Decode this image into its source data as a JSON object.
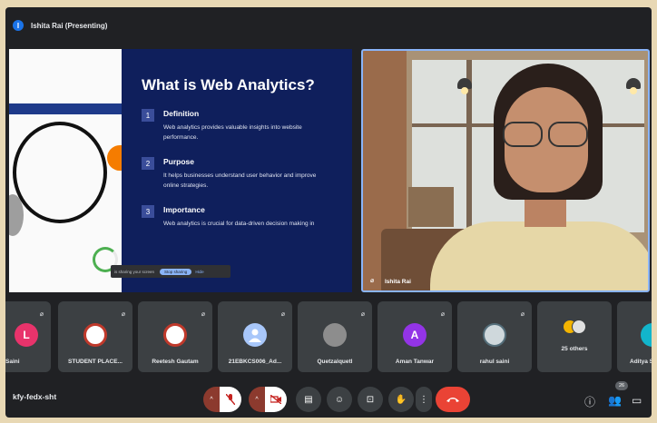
{
  "header": {
    "presenter_label": "Ishita Rai (Presenting)",
    "presenter_initial": "I"
  },
  "slide": {
    "title": "What is Web Analytics?",
    "points": [
      {
        "num": "1",
        "title": "Definition",
        "desc": "Web analytics provides valuable insights into website performance."
      },
      {
        "num": "2",
        "title": "Purpose",
        "desc": "It helps businesses understand user behavior and improve online strategies."
      },
      {
        "num": "3",
        "title": "Importance",
        "desc": "Web analytics is crucial for data-driven decision making in"
      }
    ],
    "share_text": "is sharing your screen",
    "share_stop": "Stop sharing",
    "share_hide": "Hide"
  },
  "video": {
    "name": "Ishita Rai"
  },
  "participants": [
    {
      "name": "Saini",
      "initial": "L",
      "color": "#e8336b"
    },
    {
      "name": "STUDENT PLACE...",
      "initial": "",
      "color": "#ffffff"
    },
    {
      "name": "Reetesh Gautam",
      "initial": "",
      "color": "#ffffff"
    },
    {
      "name": "21EBKCS006_Ad...",
      "initial": "",
      "color": "#a8c7fa"
    },
    {
      "name": "Quetzalquetl",
      "initial": "",
      "color": "#9e9e9e"
    },
    {
      "name": "Aman Tanwar",
      "initial": "A",
      "color": "#9334e6"
    },
    {
      "name": "rahul saini",
      "initial": "",
      "color": "#cfd8dc"
    },
    {
      "name": "25 others",
      "initial": "",
      "color": "#3c4043"
    },
    {
      "name": "Aditya S",
      "initial": "",
      "color": "#12b5cb"
    }
  ],
  "bottom": {
    "meeting_code": "kfy-fedx-sht",
    "people_count": "26"
  },
  "colors": {
    "accent": "#8ab4f8",
    "end_call": "#ea4335",
    "background": "#202124"
  }
}
